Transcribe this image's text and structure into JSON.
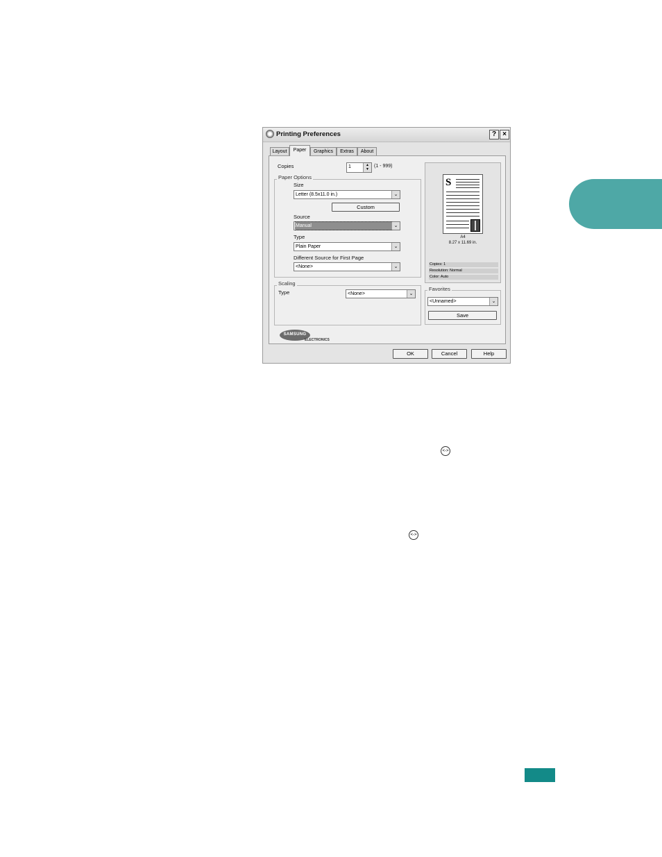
{
  "dialog": {
    "title": "Printing Preferences",
    "help_glyph": "?",
    "close_glyph": "×",
    "tabs": [
      {
        "label": "Layout"
      },
      {
        "label": "Paper"
      },
      {
        "label": "Graphics"
      },
      {
        "label": "Extras"
      },
      {
        "label": "About"
      }
    ],
    "active_tab": "Paper",
    "copies": {
      "label": "Copies",
      "value": "1",
      "range": "(1 - 999)"
    },
    "paper_options": {
      "title": "Paper Options",
      "size_label": "Size",
      "size_value": "Letter (8.5x11.0 in.)",
      "custom_label": "Custom",
      "source_label": "Source",
      "source_value": "Manual",
      "type_label": "Type",
      "type_value": "Plain Paper",
      "first_page_label": "Different Source for First Page",
      "first_page_value": "<None>"
    },
    "scaling": {
      "title": "Scaling",
      "type_label": "Type",
      "type_value": "<None>"
    },
    "preview": {
      "page_letter": "S",
      "paper_name": "A4",
      "paper_dims": "8.27 x 11.69 in.",
      "info": [
        "Copies: 1",
        "Resolution: Normal",
        "Color: Auto"
      ]
    },
    "favorites": {
      "title": "Favorites",
      "value": "<Unnamed>",
      "save_label": "Save"
    },
    "logo": {
      "brand": "SAMSUNG",
      "sub": "ELECTRONICS"
    },
    "buttons": {
      "ok": "OK",
      "cancel": "Cancel",
      "help": "Help"
    }
  },
  "body_icons": {
    "glyph": "<->"
  },
  "colors": {
    "chapter_tab": "#4ea8a6",
    "page_tab": "#138a88"
  }
}
